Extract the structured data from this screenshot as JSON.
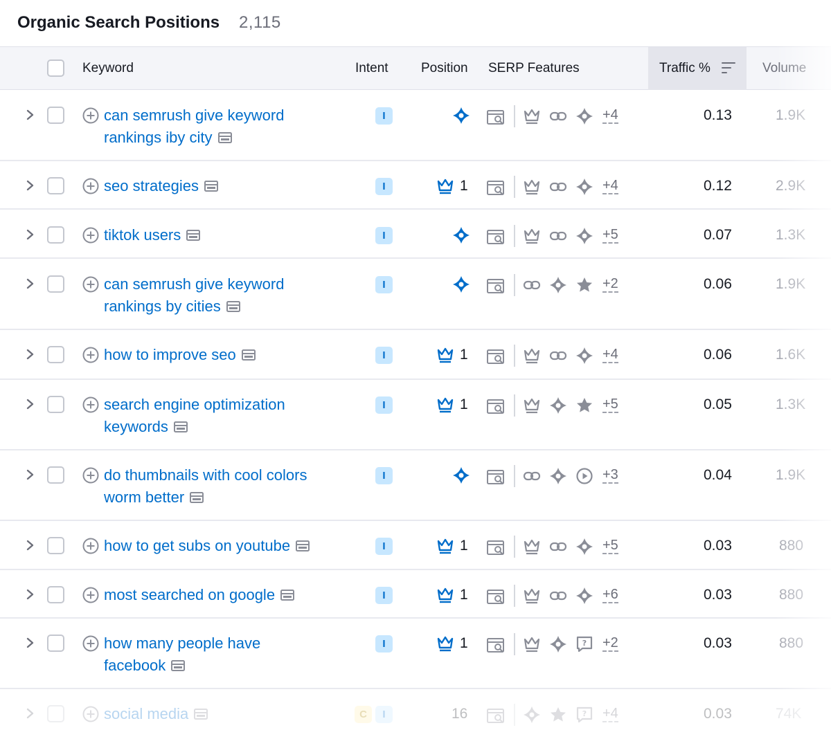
{
  "title": "Organic Search Positions",
  "count": "2,115",
  "columns": {
    "keyword": "Keyword",
    "intent": "Intent",
    "position": "Position",
    "serp": "SERP Features",
    "traffic": "Traffic %",
    "volume": "Volume"
  },
  "rows": [
    {
      "keyword_line1": "can semrush give keyword",
      "keyword_line2": "rankings iby city",
      "intent": "I",
      "position": "",
      "pos_icon": "ai-overview-icon",
      "features": [
        "crown-icon",
        "link-icon",
        "ai-overview-icon"
      ],
      "more": "+4",
      "traffic": "0.13",
      "volume": "1.9K"
    },
    {
      "keyword_line1": "seo strategies",
      "keyword_line2": "",
      "intent": "I",
      "position": "1",
      "pos_icon": "crown-icon",
      "features": [
        "crown-icon",
        "link-icon",
        "ai-overview-icon"
      ],
      "more": "+4",
      "traffic": "0.12",
      "volume": "2.9K"
    },
    {
      "keyword_line1": "tiktok users",
      "keyword_line2": "",
      "intent": "I",
      "position": "",
      "pos_icon": "ai-overview-icon",
      "features": [
        "crown-icon",
        "link-icon",
        "ai-overview-icon"
      ],
      "more": "+5",
      "traffic": "0.07",
      "volume": "1.3K"
    },
    {
      "keyword_line1": "can semrush give keyword",
      "keyword_line2": "rankings by cities",
      "intent": "I",
      "position": "",
      "pos_icon": "ai-overview-icon",
      "features": [
        "link-icon",
        "ai-overview-icon",
        "star-icon"
      ],
      "more": "+2",
      "traffic": "0.06",
      "volume": "1.9K"
    },
    {
      "keyword_line1": "how to improve seo",
      "keyword_line2": "",
      "intent": "I",
      "position": "1",
      "pos_icon": "crown-icon",
      "features": [
        "crown-icon",
        "link-icon",
        "ai-overview-icon"
      ],
      "more": "+4",
      "traffic": "0.06",
      "volume": "1.6K"
    },
    {
      "keyword_line1": "search engine optimization",
      "keyword_line2": "keywords",
      "intent": "I",
      "position": "1",
      "pos_icon": "crown-icon",
      "features": [
        "crown-icon",
        "ai-overview-icon",
        "star-icon"
      ],
      "more": "+5",
      "traffic": "0.05",
      "volume": "1.3K"
    },
    {
      "keyword_line1": "do thumbnails with cool colors",
      "keyword_line2": "worm better",
      "intent": "I",
      "position": "",
      "pos_icon": "ai-overview-icon",
      "features": [
        "link-icon",
        "ai-overview-icon",
        "video-icon"
      ],
      "more": "+3",
      "traffic": "0.04",
      "volume": "1.9K"
    },
    {
      "keyword_line1": "how to get subs on youtube",
      "keyword_line2": "",
      "intent": "I",
      "position": "1",
      "pos_icon": "crown-icon",
      "features": [
        "crown-icon",
        "link-icon",
        "ai-overview-icon"
      ],
      "more": "+5",
      "traffic": "0.03",
      "volume": "880"
    },
    {
      "keyword_line1": "most searched on google",
      "keyword_line2": "",
      "intent": "I",
      "position": "1",
      "pos_icon": "crown-icon",
      "features": [
        "crown-icon",
        "link-icon",
        "ai-overview-icon"
      ],
      "more": "+6",
      "traffic": "0.03",
      "volume": "880"
    },
    {
      "keyword_line1": "how many people have",
      "keyword_line2": "facebook",
      "intent": "I",
      "position": "1",
      "pos_icon": "crown-icon",
      "features": [
        "crown-icon",
        "ai-overview-icon",
        "faq-icon"
      ],
      "more": "+2",
      "traffic": "0.03",
      "volume": "880"
    },
    {
      "keyword_line1": "social media",
      "keyword_line2": "",
      "intent": "I",
      "intent2": "C",
      "position": "16",
      "pos_icon": "",
      "features": [
        "ai-overview-icon",
        "star-icon",
        "faq-icon"
      ],
      "more": "+4",
      "traffic": "0.03",
      "volume": "74K"
    }
  ],
  "colors": {
    "link": "#006dca",
    "intent_bg": "#c7e7ff",
    "header_bg": "#f4f5f9",
    "sorted_bg": "#e4e5ec"
  }
}
